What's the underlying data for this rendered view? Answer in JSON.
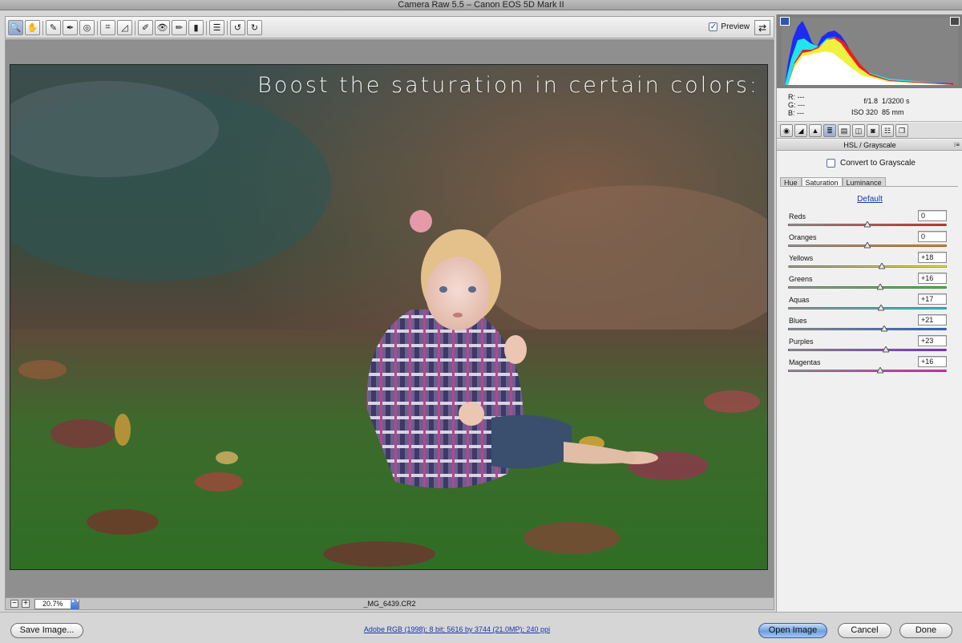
{
  "window": {
    "title": "Camera Raw 5.5  –  Canon EOS 5D Mark II"
  },
  "toolbar": {
    "tools": [
      {
        "name": "zoom-tool",
        "glyph": "🔍"
      },
      {
        "name": "hand-tool",
        "glyph": "✋"
      },
      {
        "name": "white-balance-tool",
        "glyph": "✎"
      },
      {
        "name": "color-sampler-tool",
        "glyph": "✒"
      },
      {
        "name": "targeted-adjustment-tool",
        "glyph": "◎"
      },
      {
        "name": "crop-tool",
        "glyph": "⌗"
      },
      {
        "name": "straighten-tool",
        "glyph": "◿"
      },
      {
        "name": "spot-removal-tool",
        "glyph": "✐"
      },
      {
        "name": "red-eye-removal-tool",
        "glyph": "👁"
      },
      {
        "name": "adjustment-brush-tool",
        "glyph": "✏"
      },
      {
        "name": "graduated-filter-tool",
        "glyph": "▮"
      },
      {
        "name": "preferences-tool",
        "glyph": "☰"
      },
      {
        "name": "rotate-left-tool",
        "glyph": "↺"
      },
      {
        "name": "rotate-right-tool",
        "glyph": "↻"
      }
    ],
    "preview_label": "Preview",
    "preview_checked": "✓",
    "fullscreen_glyph": "⇄"
  },
  "image": {
    "overlay_text": "Boost the saturation in certain colors:",
    "filename": "_MG_6439.CR2"
  },
  "zoom": {
    "minus": "−",
    "plus": "+",
    "level": "20.7%",
    "stepper": "▲▼"
  },
  "exif": {
    "r_label": "R:",
    "r_value": "---",
    "g_label": "G:",
    "g_value": "---",
    "b_label": "B:",
    "b_value": "---",
    "aperture": "f/1.8",
    "shutter": "1/3200 s",
    "iso": "ISO 320",
    "focal_length": "85 mm"
  },
  "panel": {
    "tab_icons": [
      "basic-icon",
      "tone-curve-icon",
      "detail-icon",
      "hsl-icon",
      "split-toning-icon",
      "lens-corrections-icon",
      "camera-calibration-icon",
      "presets-icon",
      "snapshots-icon"
    ],
    "active_tab": "hsl-icon",
    "title": "HSL / Grayscale",
    "menu_glyph": "⁝≡",
    "convert_label": "Convert to Grayscale",
    "subtabs": [
      "Hue",
      "Saturation",
      "Luminance"
    ],
    "active_subtab": "Saturation",
    "default_link": "Default",
    "sliders": [
      {
        "label": "Reds",
        "value": "0",
        "numeric": 0,
        "track": "linear-gradient(90deg,#9a9a9a,#d83a3a)"
      },
      {
        "label": "Oranges",
        "value": "0",
        "numeric": 0,
        "track": "linear-gradient(90deg,#9a9a9a,#e0852c)"
      },
      {
        "label": "Yellows",
        "value": "+18",
        "numeric": 18,
        "track": "linear-gradient(90deg,#9a9a9a,#e4e233)"
      },
      {
        "label": "Greens",
        "value": "+16",
        "numeric": 16,
        "track": "linear-gradient(90deg,#9a9a9a,#3fc23b)"
      },
      {
        "label": "Aquas",
        "value": "+17",
        "numeric": 17,
        "track": "linear-gradient(90deg,#9a9a9a,#32c8c8)"
      },
      {
        "label": "Blues",
        "value": "+21",
        "numeric": 21,
        "track": "linear-gradient(90deg,#9a9a9a,#3a6fd8)"
      },
      {
        "label": "Purples",
        "value": "+23",
        "numeric": 23,
        "track": "linear-gradient(90deg,#9a9a9a,#8b3cd4)"
      },
      {
        "label": "Magentas",
        "value": "+16",
        "numeric": 16,
        "track": "linear-gradient(90deg,#9a9a9a,#d83ab8)"
      }
    ]
  },
  "footer": {
    "save_label": "Save Image...",
    "workflow_link": "Adobe RGB (1998); 8 bit; 5616 by 3744 (21.0MP); 240 ppi",
    "open_label": "Open Image",
    "cancel_label": "Cancel",
    "done_label": "Done"
  }
}
